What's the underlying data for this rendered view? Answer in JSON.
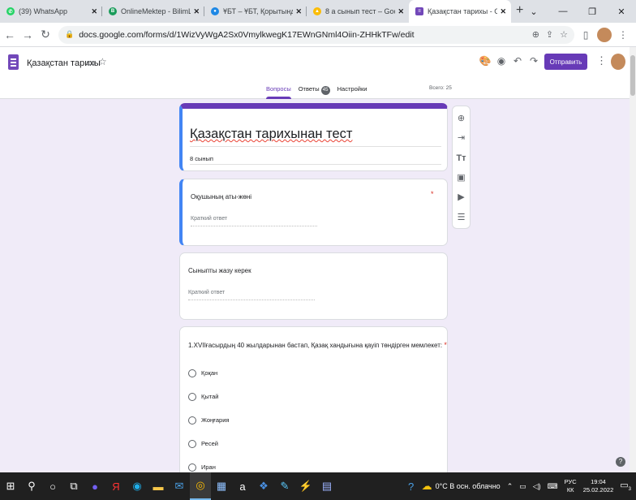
{
  "browser": {
    "tabs": [
      {
        "title": "(39) WhatsApp",
        "color": "#25d366",
        "glyph": "✆"
      },
      {
        "title": "OnlineMektep - BilimLand",
        "color": "#1a9c5a",
        "glyph": "B"
      },
      {
        "title": "ҰБТ – ҰБТ, Қорытынды аттес",
        "color": "#1e88e5",
        "glyph": "●"
      },
      {
        "title": "8 а сынып тест – Google Дис",
        "color": "#fbbc04",
        "glyph": "▲"
      },
      {
        "title": "Қазақстан тарихы - Google",
        "color": "#7248b9",
        "glyph": "≡"
      }
    ],
    "new_tab": "+",
    "url": "docs.google.com/forms/d/1WizVyWgA2Sx0VmylkwegK17EWnGNml4Oiin-ZHHkTFw/edit"
  },
  "forms_header": {
    "doc_title": "Қазақстан тарихы",
    "send_label": "Отправить",
    "tabs": {
      "questions": "Вопросы",
      "responses": "Ответы",
      "responses_count": "45",
      "settings": "Настройки"
    },
    "total_points": "Всего: 25"
  },
  "form": {
    "title": "Қазақстан тарихынан тест",
    "description": "8 сынып",
    "questions": [
      {
        "title": "Оқушының аты-жөні",
        "required": true,
        "placeholder": "Краткий ответ"
      },
      {
        "title": "Сыныпты жазу керек",
        "required": false,
        "placeholder": "Краткий ответ"
      },
      {
        "title": "1.XVIIғасырдың 40 жылдарынан бастап, Қазақ хандығына қауіп төндірген мемлекет:",
        "required": true,
        "options": [
          "Қоқан",
          "Қытай",
          "Жоңғария",
          "Ресей",
          "Иран"
        ]
      }
    ]
  },
  "float_toolbar": [
    "add-question-icon",
    "import-questions-icon",
    "add-title-icon",
    "add-image-icon",
    "add-video-icon",
    "add-section-icon"
  ],
  "taskbar": {
    "weather": "0°C  В осн. облачно",
    "language": "РУС",
    "language_sub": "КК",
    "time": "19:04",
    "date": "25.02.2022",
    "notifications": "3"
  },
  "colors": {
    "accent": "#673ab7",
    "page_bg": "#f0ebf8",
    "focus": "#4285f4",
    "required": "#d93025"
  }
}
